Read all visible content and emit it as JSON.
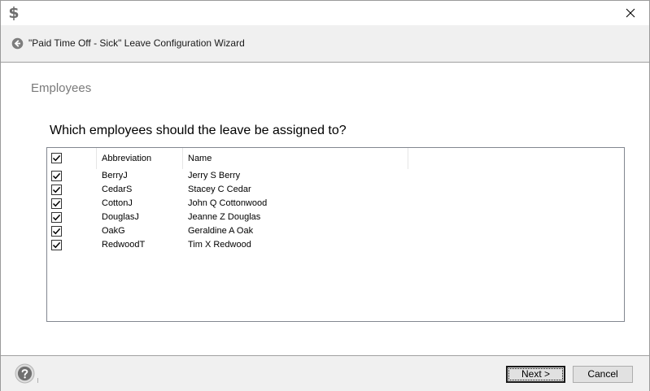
{
  "window": {
    "app_icon_glyph": "$",
    "app_icon_name": "dollar-icon",
    "close_icon_name": "close-icon"
  },
  "header": {
    "wizard_title": "\"Paid Time Off - Sick\" Leave Configuration Wizard",
    "back_icon_name": "back-arrow-icon"
  },
  "page": {
    "section_title": "Employees",
    "question": "Which employees should the leave be assigned to?"
  },
  "employee_list": {
    "select_all_checked": true,
    "columns": [
      "Abbreviation",
      "Name"
    ],
    "rows": [
      {
        "checked": true,
        "abbreviation": "BerryJ",
        "name": "Jerry S Berry"
      },
      {
        "checked": true,
        "abbreviation": "CedarS",
        "name": "Stacey C Cedar"
      },
      {
        "checked": true,
        "abbreviation": "CottonJ",
        "name": "John Q Cottonwood"
      },
      {
        "checked": true,
        "abbreviation": "DouglasJ",
        "name": "Jeanne Z Douglas"
      },
      {
        "checked": true,
        "abbreviation": "OakG",
        "name": "Geraldine A Oak"
      },
      {
        "checked": true,
        "abbreviation": "RedwoodT",
        "name": "Tim X Redwood"
      }
    ]
  },
  "footer": {
    "help_icon_name": "help-icon",
    "next_label": "Next >",
    "cancel_label": "Cancel"
  },
  "colors": {
    "band_background": "#f0f0f0",
    "section_title": "#7a7a7a",
    "list_border": "#828790"
  }
}
